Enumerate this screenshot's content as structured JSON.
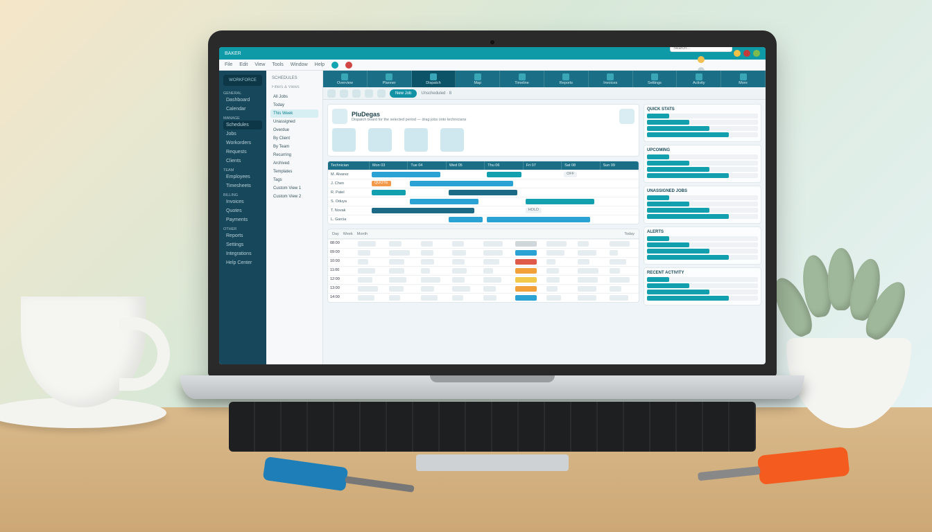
{
  "titlebar": {
    "appName": "BAKER"
  },
  "menubar": {
    "items": [
      "File",
      "Edit",
      "View",
      "Tools",
      "Window",
      "Help"
    ],
    "searchPlaceholder": "Search…"
  },
  "sidebarPrimary": {
    "logo": "WORKFORCE",
    "groups": [
      {
        "label": "GENERAL",
        "items": [
          "Dashboard",
          "Calendar"
        ]
      },
      {
        "label": "MANAGE",
        "items": [
          "Schedules",
          "Jobs",
          "Workorders",
          "Requests",
          "Clients"
        ]
      },
      {
        "label": "TEAM",
        "items": [
          "Employees",
          "Timesheets"
        ]
      },
      {
        "label": "BILLING",
        "items": [
          "Invoices",
          "Quotes",
          "Payments"
        ]
      },
      {
        "label": "OTHER",
        "items": [
          "Reports",
          "Settings",
          "Integrations",
          "Help Center"
        ]
      }
    ],
    "activeItem": "Schedules"
  },
  "sidebarSecondary": {
    "heading": "SCHEDULES",
    "subheading": "Filters & Views",
    "items": [
      "All Jobs",
      "Today",
      "This Week",
      "Unassigned",
      "Overdue",
      "By Client",
      "By Team",
      "Recurring",
      "Archived",
      "Templates",
      "Tags",
      "Custom View 1",
      "Custom View 2"
    ],
    "activeItem": "This Week"
  },
  "mainTabs": {
    "items": [
      "Overview",
      "Planner",
      "Dispatch",
      "Map",
      "Timeline",
      "Reports",
      "Invoices",
      "Settings",
      "Activity",
      "More"
    ],
    "activeIndex": 2
  },
  "toolbar": {
    "newJob": "New Job",
    "filterLabel": "Unscheduled · 8"
  },
  "panel": {
    "title": "PluDegas",
    "subtitle": "Dispatch board for the selected period — drag jobs onto technicians"
  },
  "gantt": {
    "columns": [
      "Technician",
      "Mon 03",
      "Tue 04",
      "Wed 05",
      "Thu 06",
      "Fri 07",
      "Sat 08",
      "Sun 09"
    ],
    "rows": [
      {
        "label": "M. Alvarez",
        "bars": [
          {
            "col": 1,
            "span": 2,
            "cls": "b-blue"
          },
          {
            "col": 4,
            "span": 1,
            "cls": "b-teal"
          }
        ],
        "tags": [
          {
            "col": 6,
            "text": "OFF"
          }
        ]
      },
      {
        "label": "J. Chen",
        "bars": [
          {
            "col": 2,
            "span": 3,
            "cls": "b-blue"
          }
        ],
        "tags": [
          {
            "col": 1,
            "text": "QUOTE",
            "cls": "b-orange"
          }
        ]
      },
      {
        "label": "R. Patel",
        "bars": [
          {
            "col": 1,
            "span": 1,
            "cls": "b-teal"
          },
          {
            "col": 3,
            "span": 2,
            "cls": "b-navy"
          }
        ],
        "tags": []
      },
      {
        "label": "S. Oduya",
        "bars": [
          {
            "col": 2,
            "span": 2,
            "cls": "b-blue"
          },
          {
            "col": 5,
            "span": 2,
            "cls": "b-teal"
          }
        ],
        "tags": []
      },
      {
        "label": "T. Novak",
        "bars": [
          {
            "col": 1,
            "span": 3,
            "cls": "b-navy"
          }
        ],
        "tags": [
          {
            "col": 5,
            "text": "HOLD"
          }
        ]
      },
      {
        "label": "L. Garcia",
        "bars": [
          {
            "col": 3,
            "span": 1,
            "cls": "b-blue"
          },
          {
            "col": 4,
            "span": 3,
            "cls": "b-blue"
          }
        ],
        "tags": []
      }
    ]
  },
  "schedule": {
    "toolbar": [
      "Day",
      "Week",
      "Month",
      "Today"
    ],
    "rows": [
      {
        "label": "08:00",
        "status": "st-gray"
      },
      {
        "label": "09:00",
        "status": "st-blue"
      },
      {
        "label": "10:00",
        "status": "st-red"
      },
      {
        "label": "11:00",
        "status": "st-orange"
      },
      {
        "label": "12:00",
        "status": "st-yellow"
      },
      {
        "label": "13:00",
        "status": "st-orange"
      },
      {
        "label": "14:00",
        "status": "st-blue"
      }
    ]
  },
  "rightRail": {
    "widgets": [
      {
        "title": "QUICK STATS"
      },
      {
        "title": "UPCOMING"
      },
      {
        "title": "UNASSIGNED JOBS"
      },
      {
        "title": "ALERTS"
      },
      {
        "title": "RECENT ACTIVITY"
      }
    ]
  }
}
